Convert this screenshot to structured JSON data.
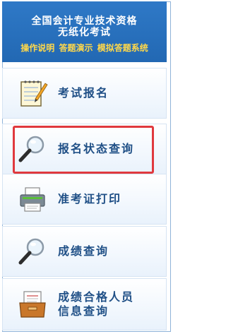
{
  "header": {
    "line1": "全国会计专业技术资格",
    "line2": "无纸化考试",
    "links": [
      "操作说明",
      "答题演示",
      "模拟答题系统"
    ]
  },
  "menu": [
    {
      "label": "考试报名",
      "icon": "notepad-pencil-icon"
    },
    {
      "label": "报名状态查询",
      "icon": "magnifier-icon"
    },
    {
      "label": "准考证打印",
      "icon": "printer-icon"
    },
    {
      "label": "成绩查询",
      "icon": "magnifier-icon"
    },
    {
      "label_line1": "成绩合格人员",
      "label_line2": "信息查询",
      "icon": "file-box-icon"
    }
  ],
  "colors": {
    "header_bg": "#2f79c7",
    "header_link": "#ffd84a",
    "menu_text": "#1f4f86",
    "highlight": "#e0393e"
  }
}
